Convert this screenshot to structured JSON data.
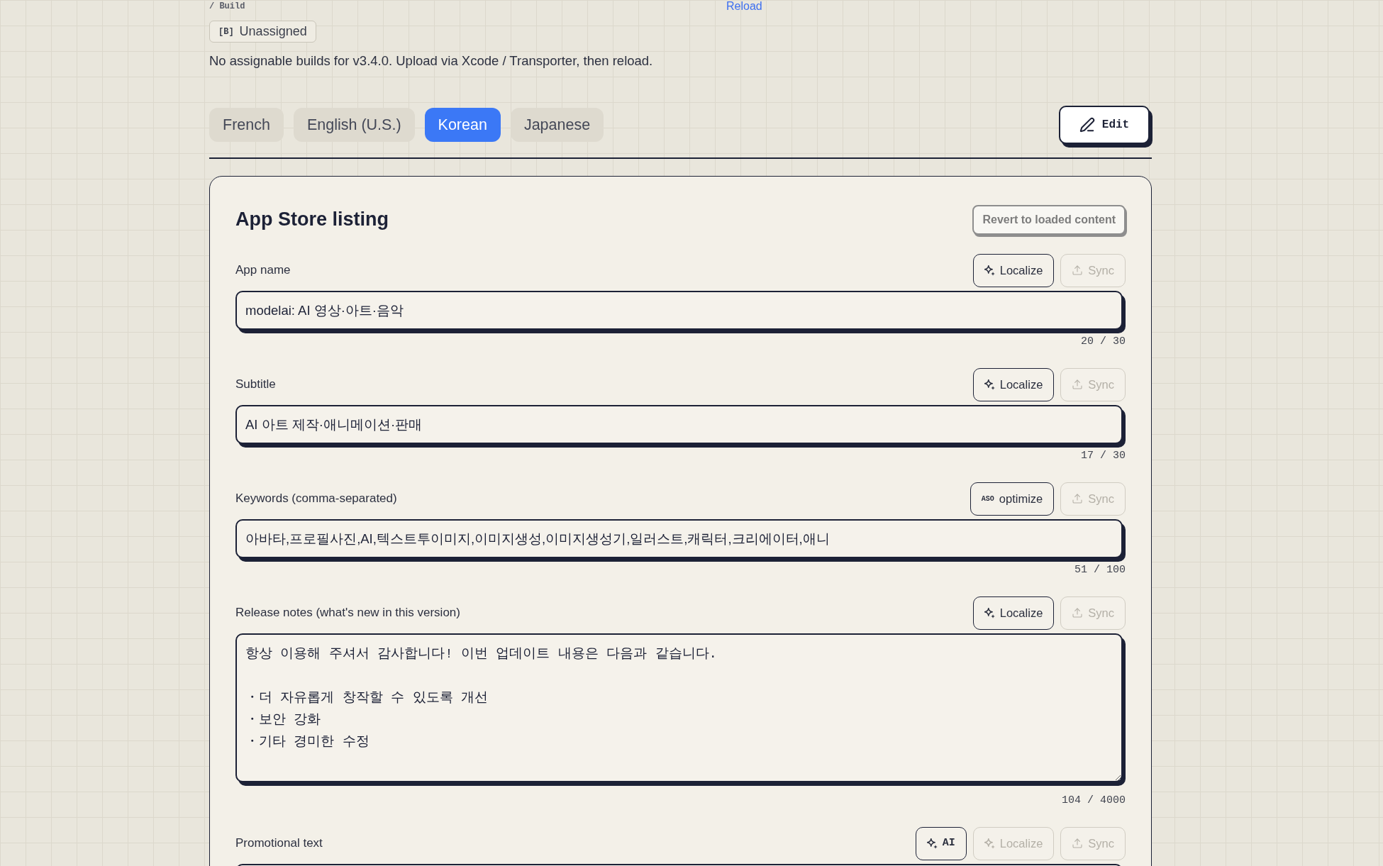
{
  "header": {
    "breadcrumb": "/ Build",
    "reload_link": "Reload"
  },
  "build": {
    "badge_code": "[B]",
    "badge_label": "Unassigned",
    "message": "No assignable builds for v3.4.0. Upload via Xcode / Transporter, then reload."
  },
  "language_tabs": [
    {
      "label": "French",
      "selected": false
    },
    {
      "label": "English (U.S.)",
      "selected": false
    },
    {
      "label": "Korean",
      "selected": true
    },
    {
      "label": "Japanese",
      "selected": false
    }
  ],
  "edit_button": {
    "label": "Edit"
  },
  "listing": {
    "title": "App Store listing",
    "revert_button": {
      "label": "Revert to loaded content",
      "disabled": true
    },
    "fields": [
      {
        "kind": "input",
        "label": "App name",
        "value": "modelai: AI 영상·아트·음악",
        "counter": "20 / 30",
        "actions": [
          {
            "kind": "localize",
            "label": "Localize",
            "disabled": false
          },
          {
            "kind": "sync",
            "label": "Sync",
            "disabled": true
          }
        ]
      },
      {
        "kind": "input",
        "label": "Subtitle",
        "value": "AI 아트 제작·애니메이션·판매",
        "counter": "17 / 30",
        "actions": [
          {
            "kind": "localize",
            "label": "Localize",
            "disabled": false
          },
          {
            "kind": "sync",
            "label": "Sync",
            "disabled": true
          }
        ]
      },
      {
        "kind": "input",
        "label": "Keywords (comma-separated)",
        "value": "아바타,프로필사진,AI,텍스트투이미지,이미지생성,이미지생성기,일러스트,캐릭터,크리에이터,애니",
        "counter": "51 / 100",
        "actions": [
          {
            "kind": "optimize",
            "tag": "ASO",
            "label": "optimize",
            "disabled": false
          },
          {
            "kind": "sync",
            "label": "Sync",
            "disabled": true
          }
        ]
      },
      {
        "kind": "textarea",
        "label": "Release notes (what's new in this version)",
        "paragraphs": [
          [
            "항상 이용해 주셔서 감사합니다! 이번 업데이트 내용은 다음과 같습니다."
          ],
          [
            "・더 자유롭게 창작할 수 있도록 개선",
            "・보안 강화",
            "・기타 경미한 수정"
          ]
        ],
        "counter": "104 / 4000",
        "actions": [
          {
            "kind": "localize",
            "label": "Localize",
            "disabled": false
          },
          {
            "kind": "sync",
            "label": "Sync",
            "disabled": true
          }
        ]
      },
      {
        "kind": "input",
        "label": "Promotional text",
        "actions": [
          {
            "kind": "ai",
            "label": "AI",
            "disabled": false
          },
          {
            "kind": "localize",
            "label": "Localize",
            "disabled": true
          },
          {
            "kind": "sync",
            "label": "Sync",
            "disabled": true
          }
        ]
      }
    ]
  }
}
